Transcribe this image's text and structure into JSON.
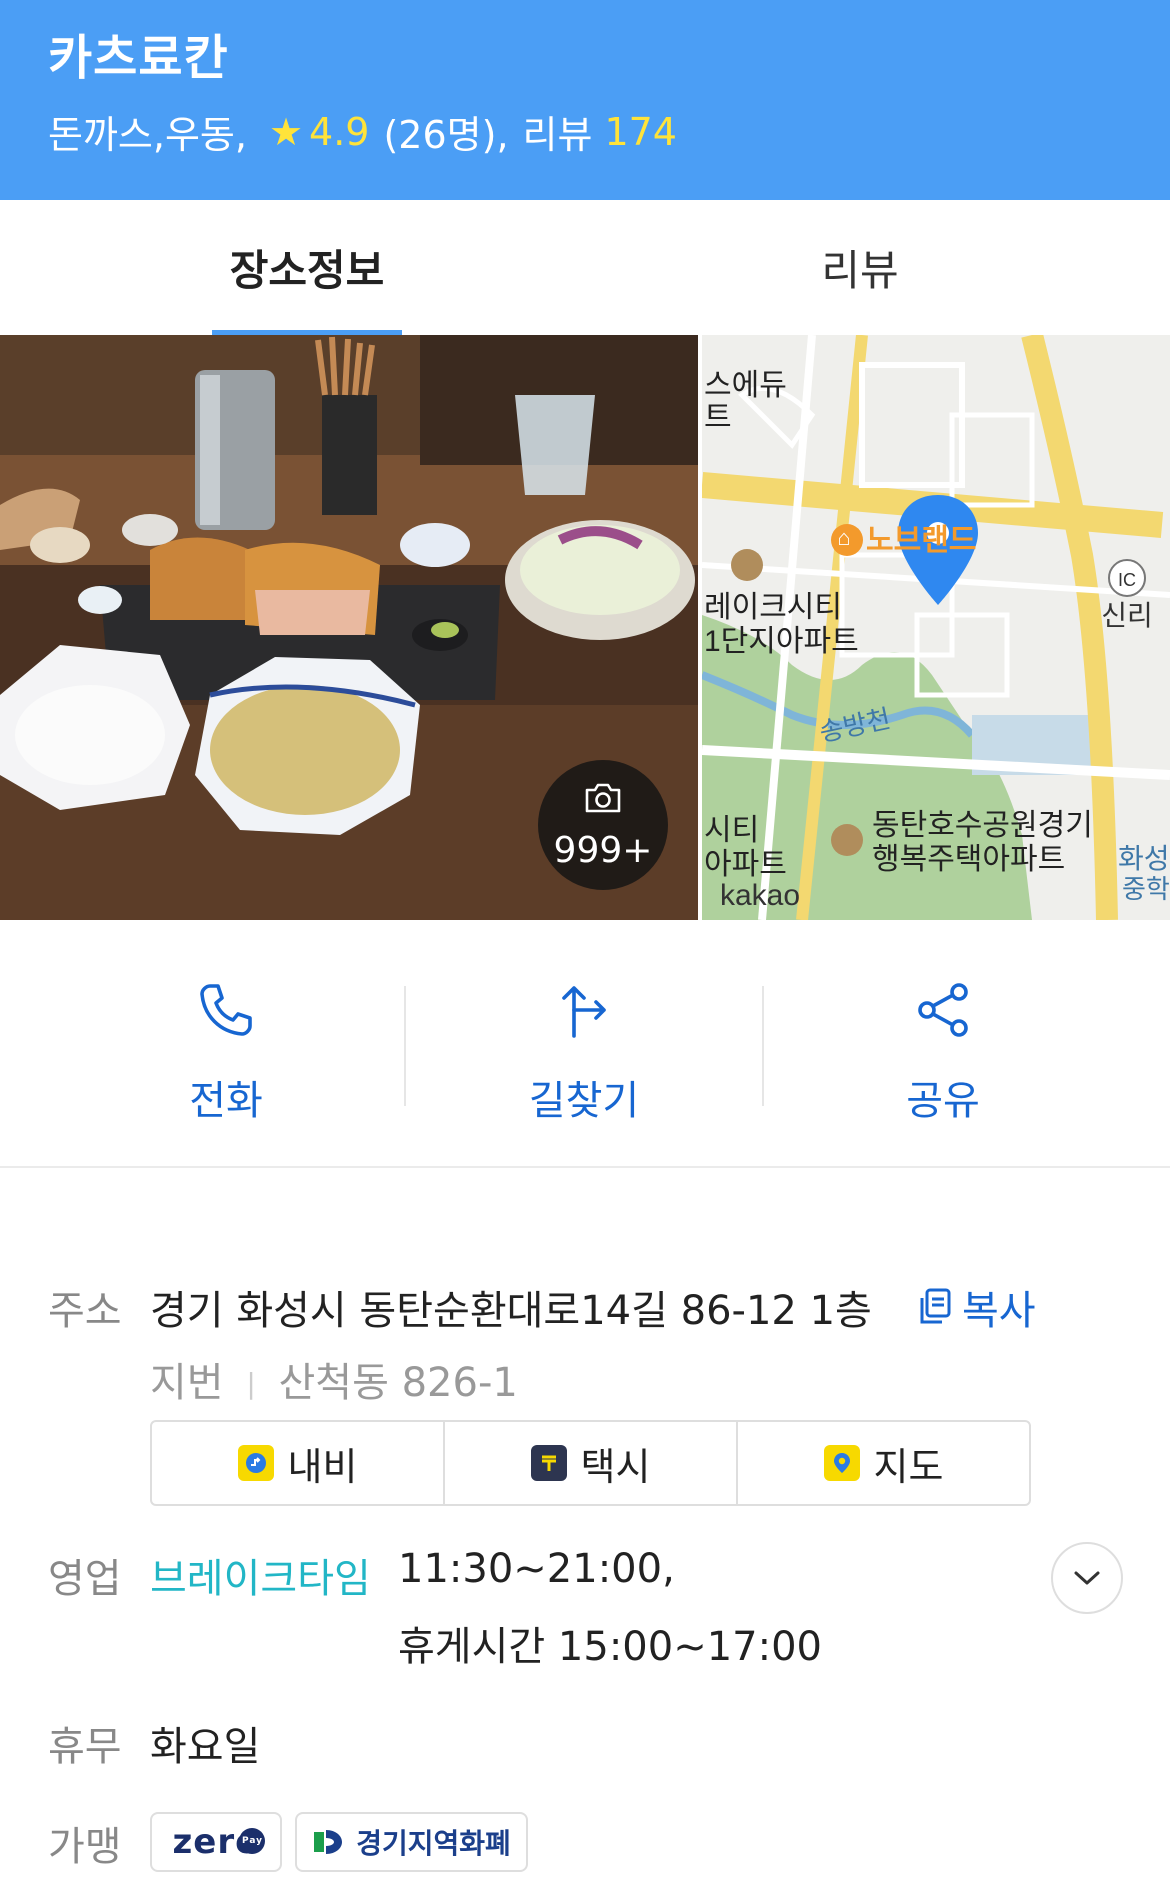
{
  "header": {
    "title": "카츠료칸",
    "category": "돈까스,우동,",
    "rating": "4.9",
    "rating_count": "(26명),",
    "review_label": "리뷰",
    "review_count": "174"
  },
  "tabs": [
    {
      "label": "장소정보",
      "active": true
    },
    {
      "label": "리뷰",
      "active": false
    }
  ],
  "photo": {
    "count": "999+",
    "icon": "camera-icon"
  },
  "map": {
    "labels": {
      "edu": "스에듀",
      "edu2": "트",
      "nobrand": "노브랜드",
      "lake1": "레이크시티",
      "lake2": "1단지아파트",
      "ic": "IC",
      "sinri": "신리",
      "songbang": "송방천",
      "park1": "동탄호수공원경기",
      "park2": "행복주택아파트",
      "city1": "시티",
      "city2": "아파트",
      "kakao": "kakao",
      "hwaseong1": "화성",
      "hwaseong2": "중학"
    }
  },
  "actions": [
    {
      "label": "전화",
      "icon": "phone-icon"
    },
    {
      "label": "길찾기",
      "icon": "directions-icon"
    },
    {
      "label": "공유",
      "icon": "share-icon"
    }
  ],
  "address": {
    "label": "주소",
    "main": "경기 화성시 동탄순환대로14길 86-12 1층",
    "copy_label": "복사",
    "jibun_label": "지번",
    "jibun_sep": "|",
    "jibun": "산척동 826-1"
  },
  "nav_buttons": [
    {
      "label": "내비",
      "icon": "navi-icon",
      "color": "#f7d900"
    },
    {
      "label": "택시",
      "icon": "taxi-icon",
      "color": "#2d3550"
    },
    {
      "label": "지도",
      "icon": "map-pin-icon",
      "color": "#f7d900"
    }
  ],
  "hours": {
    "label": "영업",
    "status": "브레이크타임",
    "line1": "11:30~21:00,",
    "line2": "휴게시간 15:00~17:00"
  },
  "holiday": {
    "label": "휴무",
    "value": "화요일"
  },
  "franchise": {
    "label": "가맹",
    "zero": "zero",
    "zero_pay": "Pay",
    "gg": "경기지역화폐"
  },
  "colors": {
    "header_bg": "#4b9ef5",
    "accent_blue": "#1766d1",
    "status_teal": "#22b6c6",
    "rating_yellow": "#ffe33a"
  }
}
